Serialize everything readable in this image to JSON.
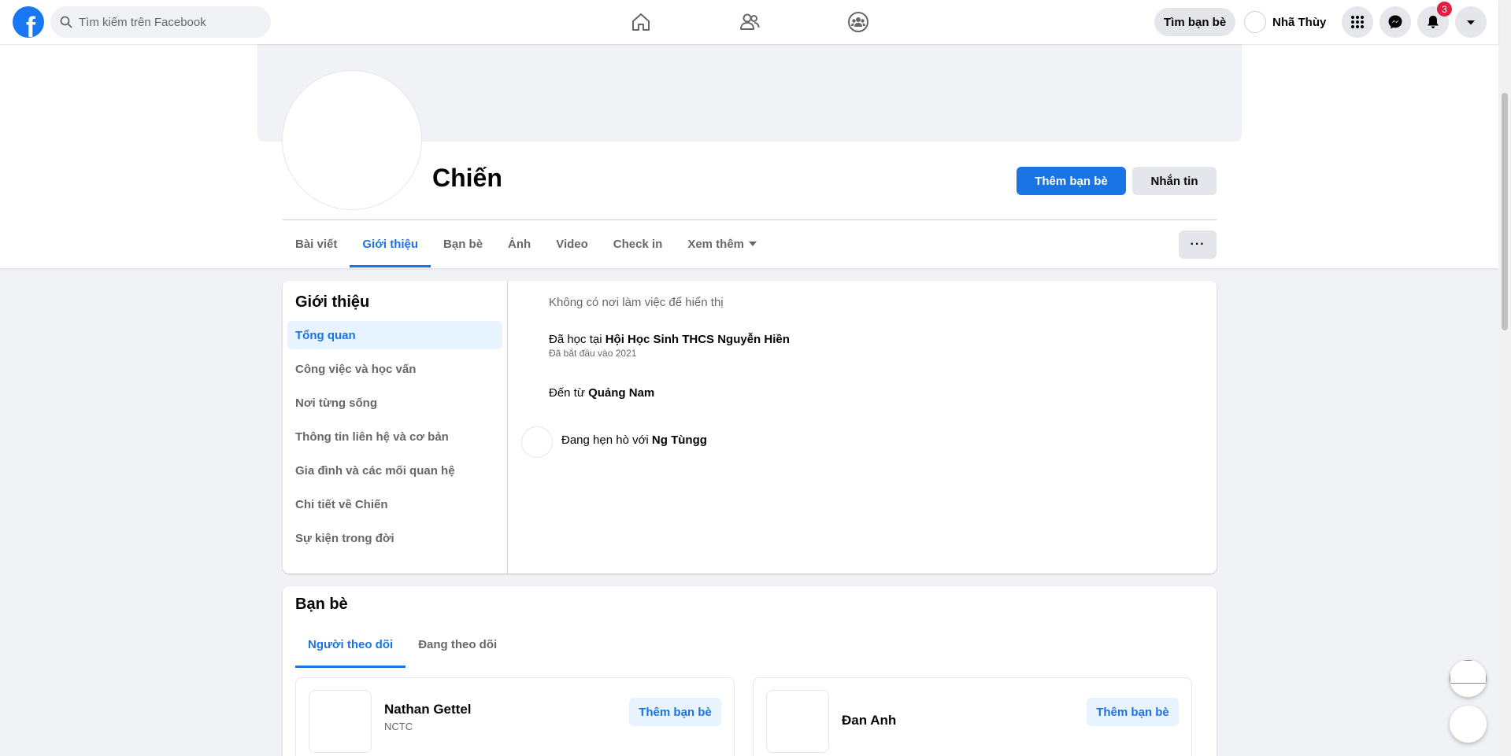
{
  "topbar": {
    "logo_letter": "f",
    "search_placeholder": "Tìm kiếm trên Facebook",
    "find_friends_label": "Tìm bạn bè",
    "user_name": "Nhã Thùy",
    "notification_count": "3",
    "nav_icons": [
      "home-icon",
      "friends-icon",
      "groups-icon"
    ],
    "right_icons": [
      "menu-grid-icon",
      "messenger-icon",
      "bell-icon",
      "account-caret-icon"
    ]
  },
  "profile": {
    "name": "Chiến",
    "add_friend_label": "Thêm bạn bè",
    "message_label": "Nhắn tin",
    "more_label": "···",
    "tabs": [
      "Bài viết",
      "Giới thiệu",
      "Bạn bè",
      "Ảnh",
      "Video",
      "Check in",
      "Xem thêm"
    ],
    "active_tab": "Giới thiệu"
  },
  "intro": {
    "title": "Giới thiệu",
    "sections": [
      "Tổng quan",
      "Công việc và học vấn",
      "Nơi từng sống",
      "Thông tin liên hệ và cơ bản",
      "Gia đình và các mối quan hệ",
      "Chi tiết về Chiến",
      "Sự kiện trong đời"
    ],
    "active_section": "Tổng quan",
    "work_empty": "Không có nơi làm việc để hiển thị",
    "studied_prefix": "Đã học tại",
    "school": "Hội Học Sinh THCS Nguyễn Hiền",
    "school_since": "Đã bắt đầu vào 2021",
    "from_prefix": "Đến từ",
    "hometown": "Quảng Nam",
    "relationship_prefix": "Đang hẹn hò với",
    "partner": "Ng Tùngg"
  },
  "friends": {
    "title": "Bạn bè",
    "tabs": [
      "Người theo dõi",
      "Đang theo dõi"
    ],
    "active_tab": "Người theo dõi",
    "items": [
      {
        "name": "Nathan Gettel",
        "sub": "NCTC",
        "action": "Thêm bạn bè"
      },
      {
        "name": "Đan Anh",
        "sub": "",
        "action": "Thêm bạn bè"
      }
    ]
  },
  "colors": {
    "brand": "#1877f2",
    "accent": "#1b74e4",
    "badge": "#e41e3f"
  }
}
